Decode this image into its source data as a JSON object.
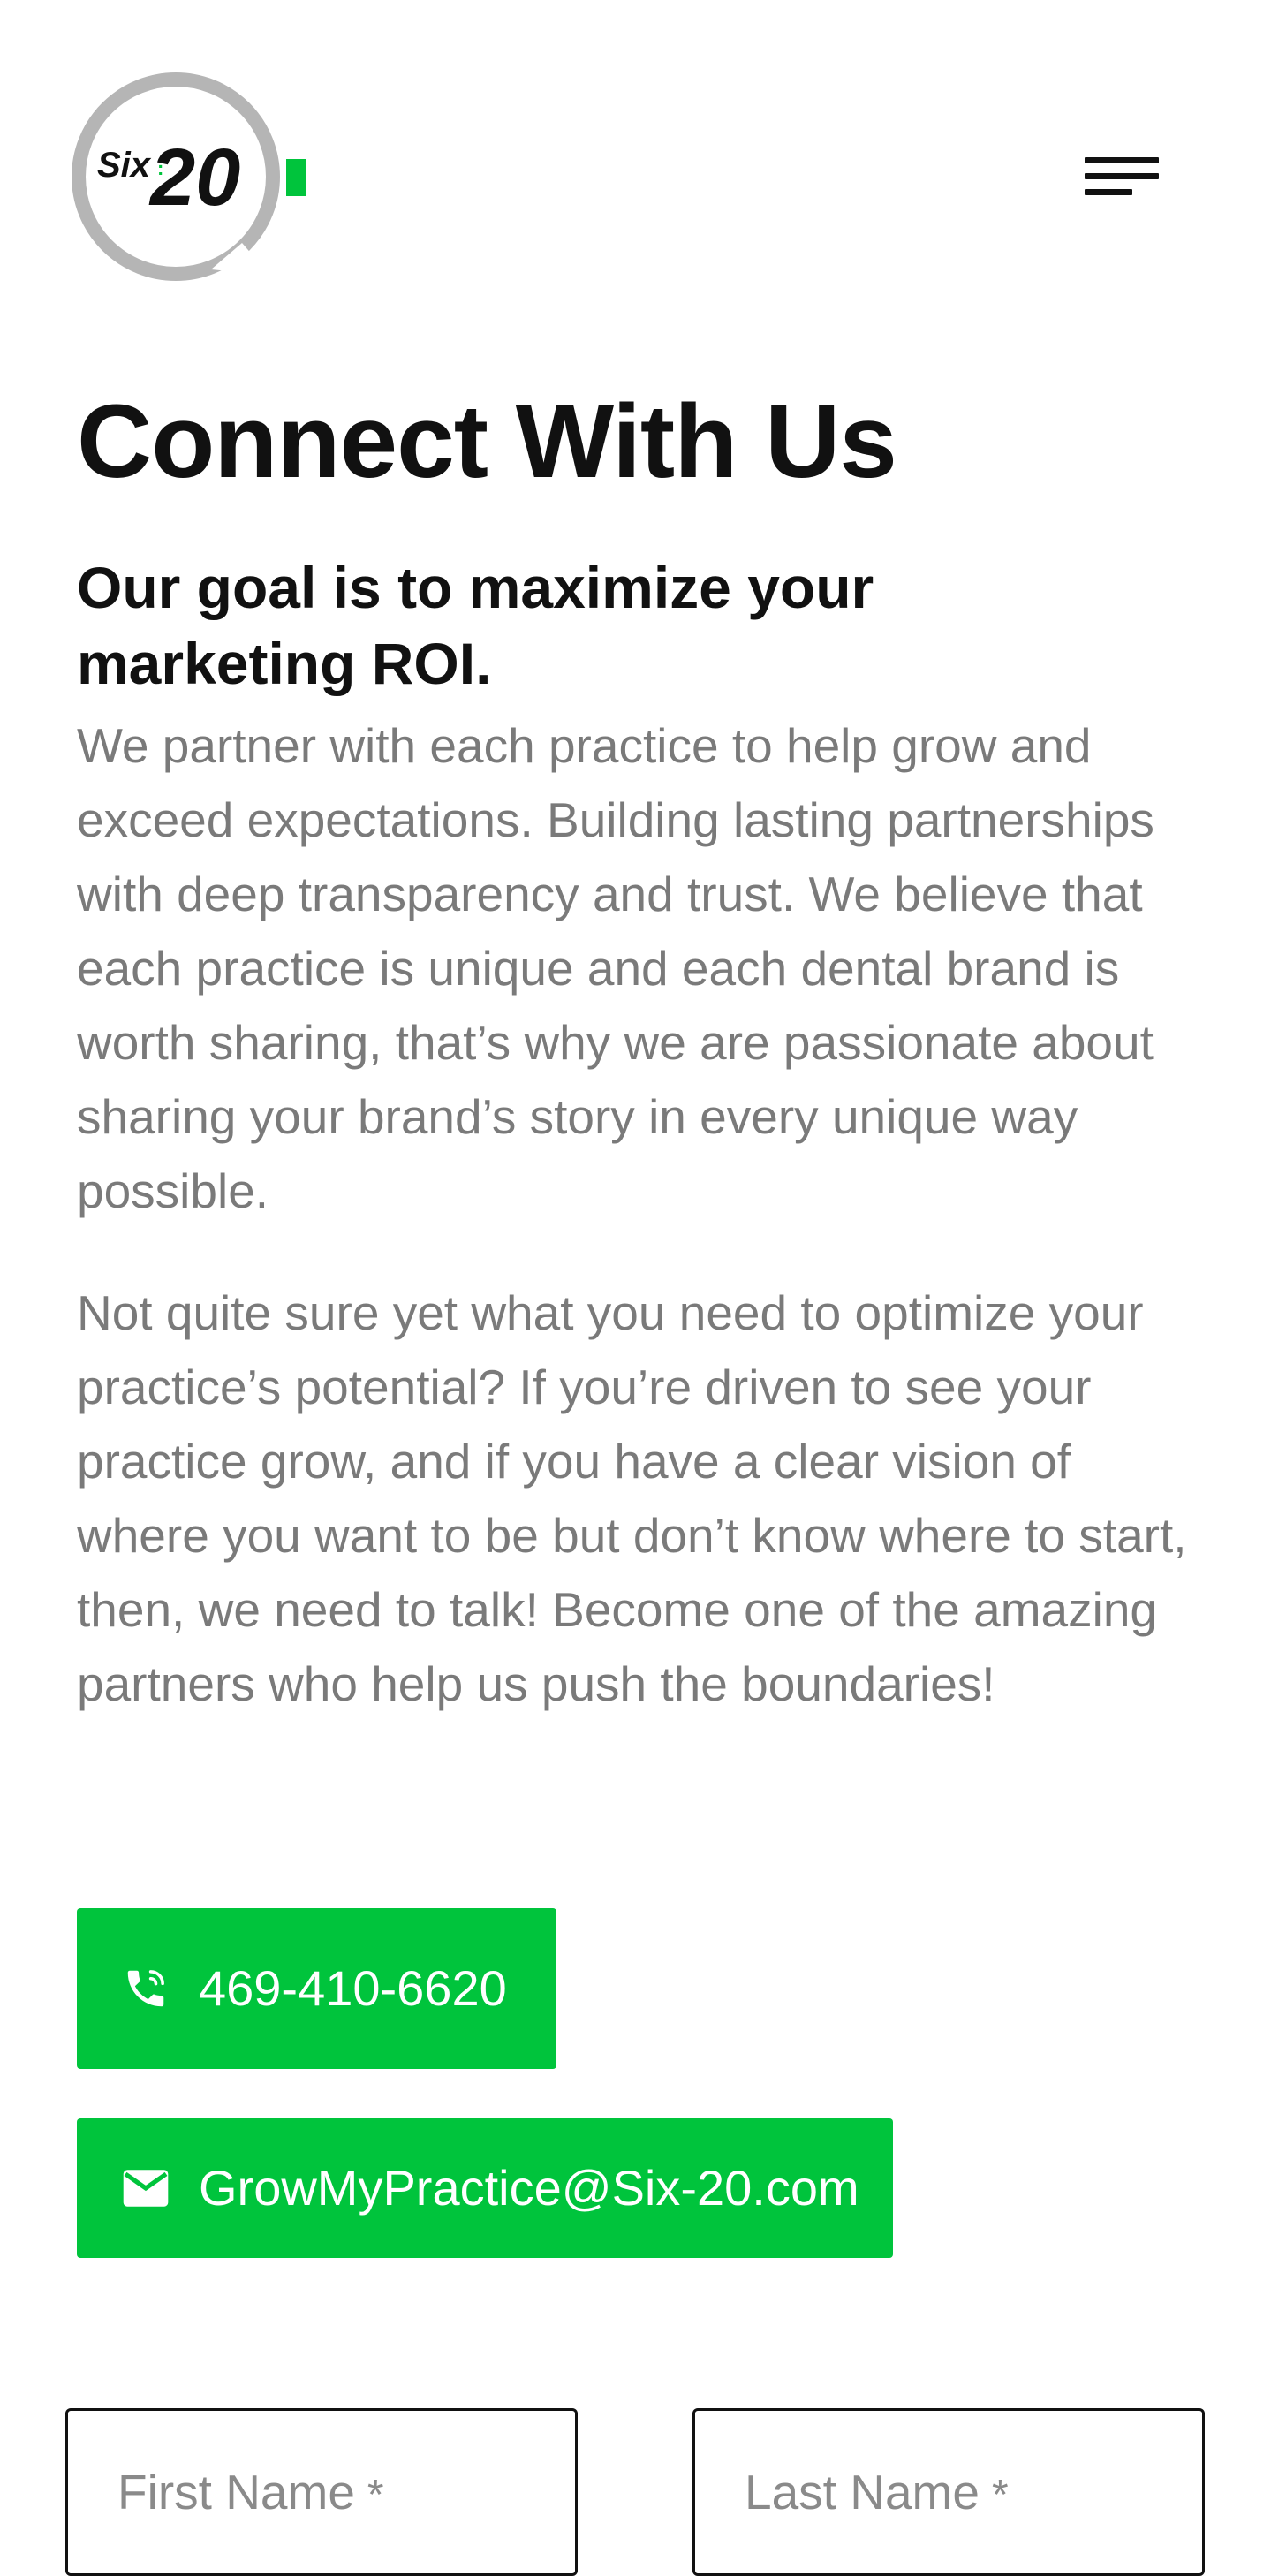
{
  "header": {
    "logo": {
      "prefix": "Six",
      "number": "20",
      "colors": {
        "ring": "#b5b5b5",
        "accent": "#00c43c",
        "text": "#111111"
      }
    },
    "menu_icon": "hamburger-menu-icon"
  },
  "main": {
    "title": "Connect With Us",
    "subtitle": "Our goal is to maximize your marketing ROI.",
    "paragraphs": [
      "We partner with each practice to help grow and exceed expectations. Building lasting partnerships with deep transparency and trust. We believe that each practice is unique and each dental brand is worth sharing, that’s why we are passionate about sharing your brand’s story in every unique way possible.",
      "Not quite sure yet what you need to optimize your practice’s potential? If you’re driven to see your practice grow, and if you have a clear vision of where you want to be but don’t know where to start, then, we need to talk! Become one of the amazing partners who help us push the boundaries!"
    ]
  },
  "contact": {
    "phone": {
      "label": "469-410-6620",
      "icon": "phone-icon"
    },
    "email": {
      "label": "GrowMyPractice@Six-20.com",
      "icon": "mail-icon"
    },
    "button_color": "#00c43c"
  },
  "form": {
    "first_name": {
      "label": "First Name",
      "required_mark": "*"
    },
    "last_name": {
      "label": "Last Name",
      "required_mark": "*"
    }
  }
}
